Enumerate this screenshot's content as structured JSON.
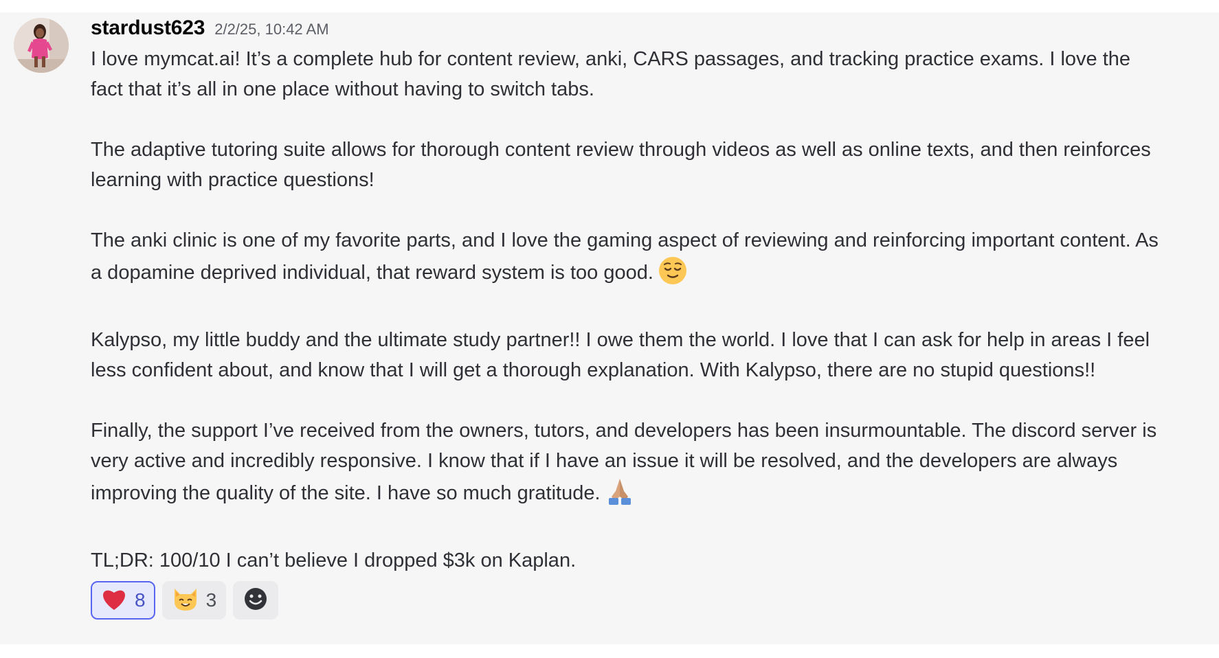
{
  "message": {
    "username": "stardust623",
    "timestamp": "2/2/25, 10:42 AM",
    "paragraphs": {
      "p1": "I love mymcat.ai! It’s a complete hub for content review, anki, CARS passages, and tracking practice exams. I love the fact that it’s all in one place without having to switch tabs.",
      "p2": "The adaptive tutoring suite allows for thorough content review through videos as well as online texts, and then reinforces learning with practice questions!",
      "p3": "The anki clinic is one of my favorite parts, and I love the gaming aspect of reviewing and reinforcing important content. As a dopamine deprived individual, that reward system is too good.",
      "p4": "Kalypso, my little buddy and the ultimate study partner!! I owe them the world. I love that I can ask for help in areas I feel less confident about, and know that I will get a thorough explanation. With Kalypso, there are no stupid questions!!",
      "p5": "Finally, the support I’ve received from the owners, tutors, and developers has been insurmountable. The discord server is very active and incredibly responsive. I know that if I have an issue it will be resolved, and the developers are always improving the quality of the site. I have so much gratitude.",
      "p6": "TL;DR: 100/10 I can’t believe I dropped $3k on Kaplan."
    },
    "inline_emojis": {
      "p3": "relieved-face-emoji",
      "p5": "folded-hands-emoji"
    }
  },
  "reactions": [
    {
      "emoji": "heart-emoji",
      "count": "8",
      "active": true
    },
    {
      "emoji": "cat-face-emoji",
      "count": "3",
      "active": false
    }
  ],
  "add_reaction_icon": "smiley-add-reaction-icon",
  "colors": {
    "background": "#f6f6f6",
    "active_reaction_border": "#5865f2",
    "active_reaction_bg": "#e6e8fb",
    "heart": "#dd2e44"
  }
}
